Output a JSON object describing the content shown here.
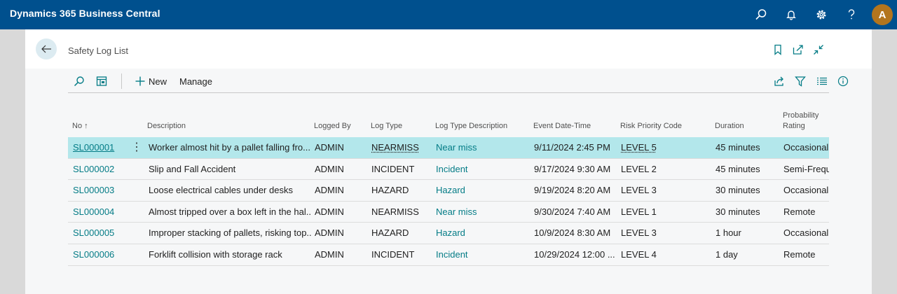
{
  "app": {
    "title": "Dynamics 365 Business Central",
    "user_initial": "A"
  },
  "colors": {
    "topbar": "#00508e",
    "accent_link": "#047c86",
    "selected_row": "#b3e7eb",
    "avatar": "#b3751d"
  },
  "topbar_icons": [
    "search-icon",
    "bell-icon",
    "gear-icon",
    "help-icon"
  ],
  "page": {
    "title": "Safety Log List"
  },
  "actions": {
    "new_label": "New",
    "manage_label": "Manage"
  },
  "grid": {
    "columns": {
      "no": "No",
      "no_sort": "↑",
      "description": "Description",
      "logged_by": "Logged By",
      "log_type": "Log Type",
      "log_type_description": "Log Type Description",
      "event_datetime": "Event Date-Time",
      "risk_priority_code": "Risk Priority Code",
      "duration": "Duration",
      "probability_rating_line1": "Probability",
      "probability_rating_line2": "Rating"
    },
    "rows": [
      {
        "no": "SL000001",
        "description": "Worker almost hit by a pallet falling fro...",
        "logged_by": "ADMIN",
        "log_type": "NEARMISS",
        "log_type_description": "Near miss",
        "event_datetime": "9/11/2024 2:45 PM",
        "risk_priority_code": "LEVEL 5",
        "duration": "45 minutes",
        "probability_rating": "Occasional"
      },
      {
        "no": "SL000002",
        "description": "Slip and Fall Accident",
        "logged_by": "ADMIN",
        "log_type": "INCIDENT",
        "log_type_description": "Incident",
        "event_datetime": "9/17/2024 9:30 AM",
        "risk_priority_code": "LEVEL 2",
        "duration": "45 minutes",
        "probability_rating": "Semi-Frequ"
      },
      {
        "no": "SL000003",
        "description": "Loose electrical cables under desks",
        "logged_by": "ADMIN",
        "log_type": "HAZARD",
        "log_type_description": "Hazard",
        "event_datetime": "9/19/2024 8:20 AM",
        "risk_priority_code": "LEVEL 3",
        "duration": "30 minutes",
        "probability_rating": "Occasional"
      },
      {
        "no": "SL000004",
        "description": "Almost tripped over a box left in the hal...",
        "logged_by": "ADMIN",
        "log_type": "NEARMISS",
        "log_type_description": "Near miss",
        "event_datetime": "9/30/2024 7:40 AM",
        "risk_priority_code": "LEVEL 1",
        "duration": "30 minutes",
        "probability_rating": "Remote"
      },
      {
        "no": "SL000005",
        "description": "Improper stacking of pallets, risking top...",
        "logged_by": "ADMIN",
        "log_type": "HAZARD",
        "log_type_description": "Hazard",
        "event_datetime": "10/9/2024 8:30 AM",
        "risk_priority_code": "LEVEL 3",
        "duration": "1 hour",
        "probability_rating": "Occasional"
      },
      {
        "no": "SL000006",
        "description": "Forklift collision with storage rack",
        "logged_by": "ADMIN",
        "log_type": "INCIDENT",
        "log_type_description": "Incident",
        "event_datetime": "10/29/2024 12:00 ...",
        "risk_priority_code": "LEVEL 4",
        "duration": "1 day",
        "probability_rating": "Remote"
      }
    ],
    "selected_row": 0
  }
}
